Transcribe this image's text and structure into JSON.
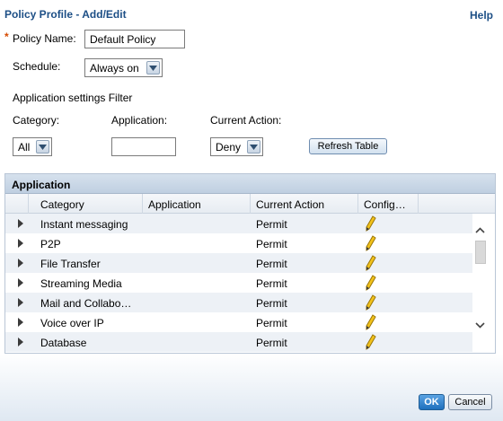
{
  "header": {
    "title": "Policy Profile - Add/Edit",
    "help": "Help"
  },
  "form": {
    "required_marker": "*",
    "policy_name_label": "Policy Name:",
    "policy_name_value": "Default Policy",
    "schedule_label": "Schedule:",
    "schedule_value": "Always on"
  },
  "filter": {
    "title": "Application settings Filter",
    "category_label": "Category:",
    "category_value": "All",
    "application_label": "Application:",
    "application_value": "",
    "current_action_label": "Current Action:",
    "current_action_value": "Deny",
    "refresh_label": "Refresh Table"
  },
  "table": {
    "panel_title": "Application",
    "columns": [
      "Category",
      "Application",
      "Current Action",
      "Config…"
    ],
    "rows": [
      {
        "category": "Instant messaging",
        "application": "",
        "action": "Permit"
      },
      {
        "category": "P2P",
        "application": "",
        "action": "Permit"
      },
      {
        "category": "File Transfer",
        "application": "",
        "action": "Permit"
      },
      {
        "category": "Streaming Media",
        "application": "",
        "action": "Permit"
      },
      {
        "category": "Mail and Collabo…",
        "application": "",
        "action": "Permit"
      },
      {
        "category": "Voice over IP",
        "application": "",
        "action": "Permit"
      },
      {
        "category": "Database",
        "application": "",
        "action": "Permit"
      }
    ],
    "config_icon": "pencil-icon"
  },
  "buttons": {
    "ok": "OK",
    "cancel": "Cancel"
  },
  "colors": {
    "title": "#1d4f86",
    "required": "#d54a00",
    "ok_button": "#1f70bd"
  }
}
